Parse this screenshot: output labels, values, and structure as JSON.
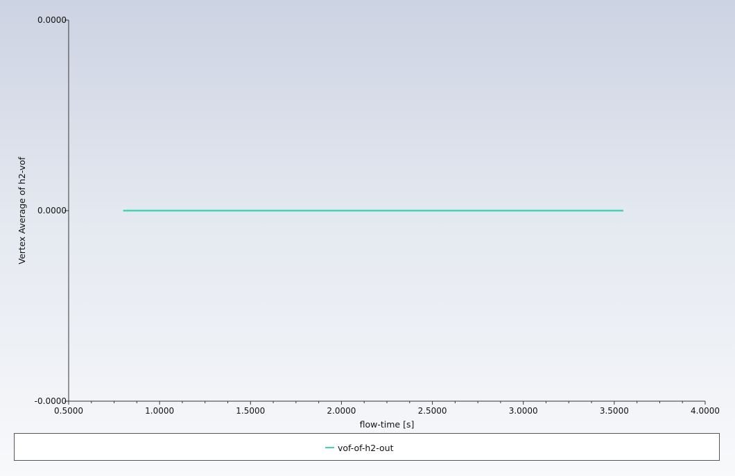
{
  "chart_data": {
    "type": "line",
    "title": "",
    "xlabel": "flow-time [s]",
    "ylabel": "Vertex Average of h2-vof",
    "xlim": [
      0.5,
      4.0
    ],
    "ylim": [
      -1,
      1
    ],
    "x_ticks": [
      "0.5000",
      "1.0000",
      "1.5000",
      "2.0000",
      "2.5000",
      "3.0000",
      "3.5000",
      "4.0000"
    ],
    "x_tick_values": [
      0.5,
      1.0,
      1.5,
      2.0,
      2.5,
      3.0,
      3.5,
      4.0
    ],
    "x_minor_ticks_per_interval": 3,
    "y_ticks": [
      "0.0000",
      "0.0000",
      "-0.0000"
    ],
    "y_tick_values": [
      1,
      0,
      -1
    ],
    "grid": false,
    "legend_position": "bottom",
    "series": [
      {
        "name": "vof-of-h2-out",
        "color": "#3fd4b6",
        "x": [
          0.8,
          3.55
        ],
        "y": [
          0,
          0
        ]
      }
    ]
  }
}
